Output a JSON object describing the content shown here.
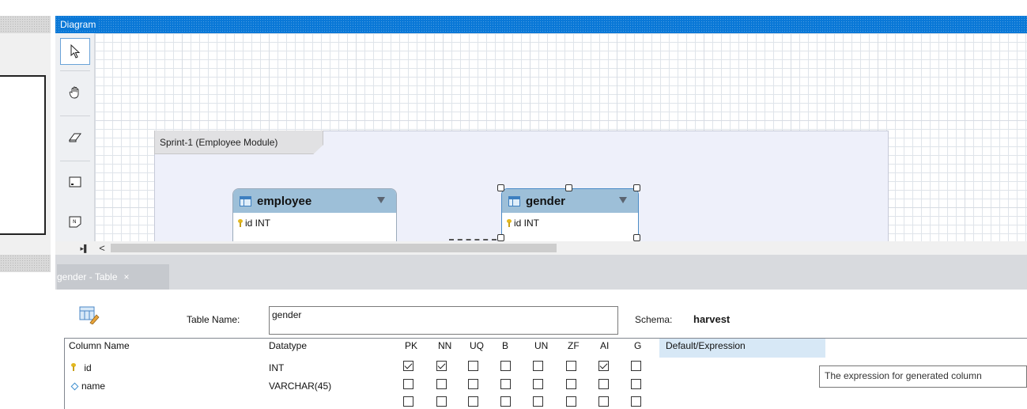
{
  "diagram": {
    "title": "Diagram",
    "tools": [
      {
        "name": "pointer-icon"
      },
      {
        "name": "hand-icon"
      },
      {
        "name": "eraser-icon"
      },
      {
        "name": "layer-icon"
      },
      {
        "name": "note-icon"
      }
    ],
    "layer": {
      "label": "Sprint-1 (Employee Module)"
    },
    "tables": [
      {
        "name": "employee",
        "columns": [
          "id INT"
        ]
      },
      {
        "name": "gender",
        "columns": [
          "id INT"
        ],
        "selected": true
      }
    ]
  },
  "tab": {
    "label": "gender - Table",
    "close": "×"
  },
  "editor": {
    "table_name_label": "Table Name:",
    "table_name_value": "gender",
    "schema_label": "Schema:",
    "schema_value": "harvest",
    "headers": [
      "Column Name",
      "Datatype",
      "PK",
      "NN",
      "UQ",
      "B",
      "UN",
      "ZF",
      "AI",
      "G",
      "Default/Expression"
    ],
    "rows": [
      {
        "icon": "key-icon",
        "name": "id",
        "datatype": "INT",
        "flags": [
          true,
          true,
          false,
          false,
          false,
          false,
          true,
          false
        ]
      },
      {
        "icon": "diamond-icon",
        "name": "name",
        "datatype": "VARCHAR(45)",
        "flags": [
          false,
          false,
          false,
          false,
          false,
          false,
          false,
          false
        ]
      },
      {
        "icon": "",
        "name": "",
        "datatype": "",
        "flags": [
          false,
          false,
          false,
          false,
          false,
          false,
          false,
          false
        ]
      }
    ],
    "tooltip": "The expression for generated column"
  },
  "scroll": {
    "left_arrow": "<"
  }
}
